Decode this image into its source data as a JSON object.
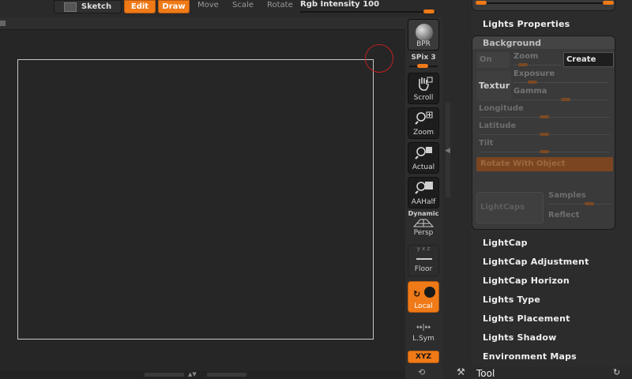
{
  "toolbar": {
    "sketch": "Sketch",
    "edit": "Edit",
    "draw": "Draw",
    "move": "Move",
    "scale": "Scale",
    "rotate": "Rotate",
    "rgb_intensity_label": "Rgb Intensity",
    "rgb_intensity_value": "100"
  },
  "shelf": {
    "bpr": "BPR",
    "spix_label": "SPix 3",
    "scroll": "Scroll",
    "zoom": "Zoom",
    "actual": "Actual",
    "aahalf": "AAHalf",
    "dynamic": "Dynamic",
    "persp": "Persp",
    "floor": "Floor",
    "local": "Local",
    "lsym": "L.Sym",
    "xyz": "XYZ"
  },
  "palette": {
    "lights_properties": "Lights Properties",
    "background_title": "Background",
    "on": "On",
    "zoom": "Zoom",
    "create": "Create",
    "exposure": "Exposure",
    "texture": "Textur",
    "gamma": "Gamma",
    "longitude": "Longitude",
    "latitude": "Latitude",
    "tilt": "Tilt",
    "rotate_with_object": "Rotate With Object",
    "lightcaps": "LightCaps",
    "samples": "Samples",
    "reflect": "Reflect",
    "menu": [
      "LightCap",
      "LightCap Adjustment",
      "LightCap Horizon",
      "Lights Type",
      "Lights Placement",
      "Lights Shadow",
      "Environment Maps"
    ],
    "tool": "Tool"
  }
}
